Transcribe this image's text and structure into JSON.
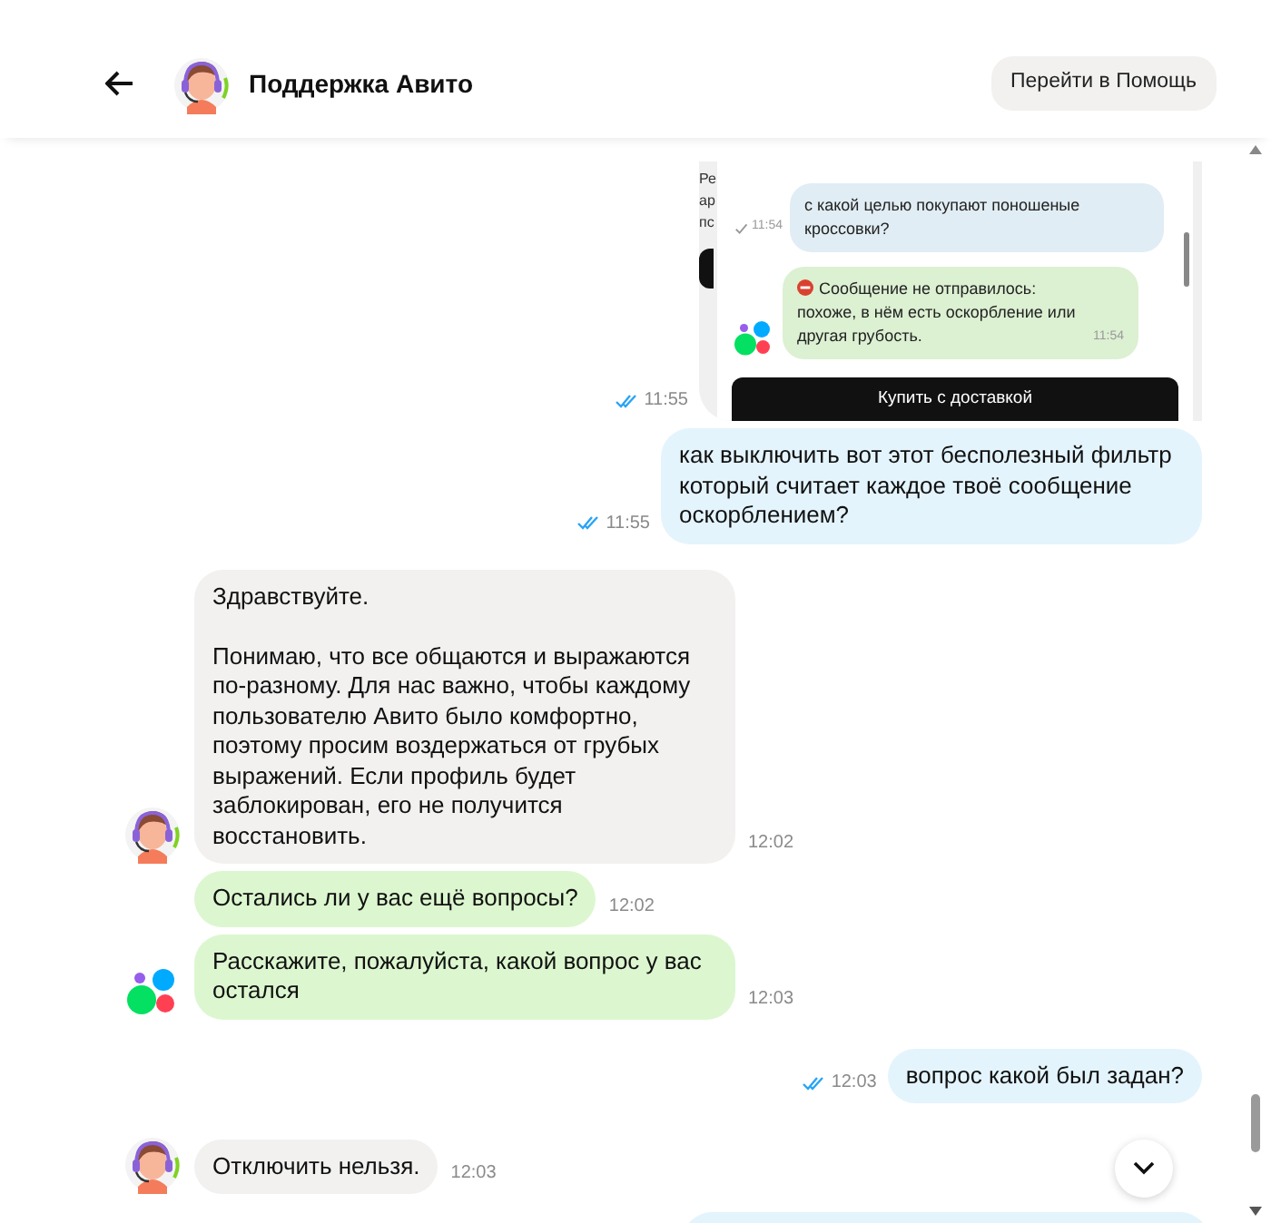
{
  "header": {
    "title": "Поддержка Авито",
    "help_button": "Перейти в Помощь"
  },
  "messages": [
    {
      "kind": "screenshot",
      "show_avatar": false,
      "read": true,
      "time": "11:55",
      "screenshot": {
        "cut_text": [
          "Ре",
          "ар",
          "пс"
        ],
        "messages": [
          {
            "kind": "outgoing",
            "text": "с какой целью покупают поношеные кроссовки?",
            "time": "11:54",
            "read": false,
            "error": false
          },
          {
            "kind": "bot",
            "text": "Сообщение не отправилось: похоже, в нём есть оскорбление или другая грубость.",
            "time": "11:54",
            "error": true
          }
        ],
        "button": "Купить с доставкой"
      }
    },
    {
      "kind": "outgoing",
      "show_avatar": false,
      "read": true,
      "time": "11:55",
      "text": "как выключить вот этот бесполезный фильтр который считает каждое твоё сообщение оскорблением?"
    },
    {
      "kind": "agent",
      "show_avatar": true,
      "time": "12:02",
      "text": "Здравствуйте.\n\nПонимаю, что все общаются и выражаются по-разному. Для нас важно, чтобы каждому пользователю Авито было комфортно, поэтому просим воздержаться от грубых выражений. Если профиль будет заблокирован, его не получится восстановить."
    },
    {
      "kind": "bot",
      "show_avatar": false,
      "time": "12:02",
      "text": "Остались ли у вас ещё вопросы?"
    },
    {
      "kind": "bot",
      "show_avatar": true,
      "time": "12:03",
      "text": "Расскажите, пожалуйста, какой вопрос у вас остался"
    },
    {
      "kind": "outgoing",
      "show_avatar": false,
      "read": true,
      "time": "12:03",
      "text": "вопрос какой был задан?"
    },
    {
      "kind": "agent",
      "show_avatar": true,
      "time": "12:03",
      "text": "Отключить нельзя."
    },
    {
      "kind": "cut"
    }
  ]
}
